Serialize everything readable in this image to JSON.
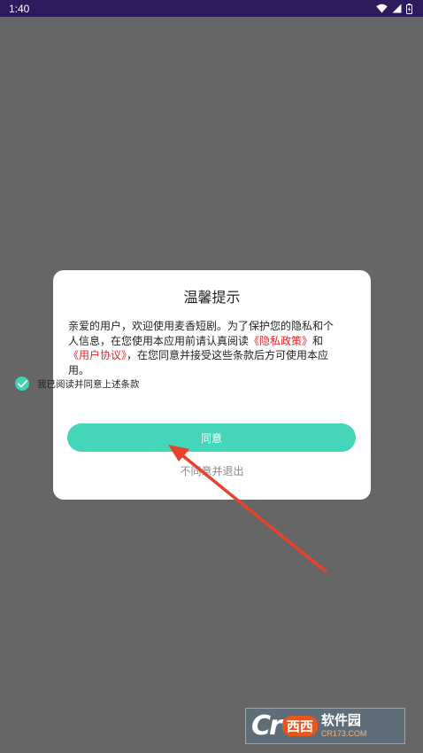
{
  "status_bar": {
    "time": "1:40"
  },
  "dialog": {
    "title": "温馨提示",
    "body": {
      "line1": "亲爱的用户，欢迎使用麦香短剧。为了保护您的隐私和个",
      "line2_a": "人信息，在您使用本应用前请认真阅读",
      "privacy_link": "《隐私政策》",
      "line2_b": "和",
      "user_agreement_link": "《用户协议》",
      "line3": "，在您同意并接受这些条款后方可使用本应",
      "line4": "用。"
    },
    "agree_checkbox": {
      "label": "我已阅读并同意上述条款",
      "checked": true
    },
    "agree_button": "同意",
    "decline_link": "不同意并退出"
  },
  "watermark": {
    "logo": "Cr",
    "badge": "西西",
    "name": "软件园",
    "domain": "CR173.COM"
  },
  "colors": {
    "accent": "#43d6b8",
    "link": "#e52424",
    "overlay": "#666666",
    "status_bar": "#2d1b5e",
    "annotation_arrow": "#e8412c"
  }
}
